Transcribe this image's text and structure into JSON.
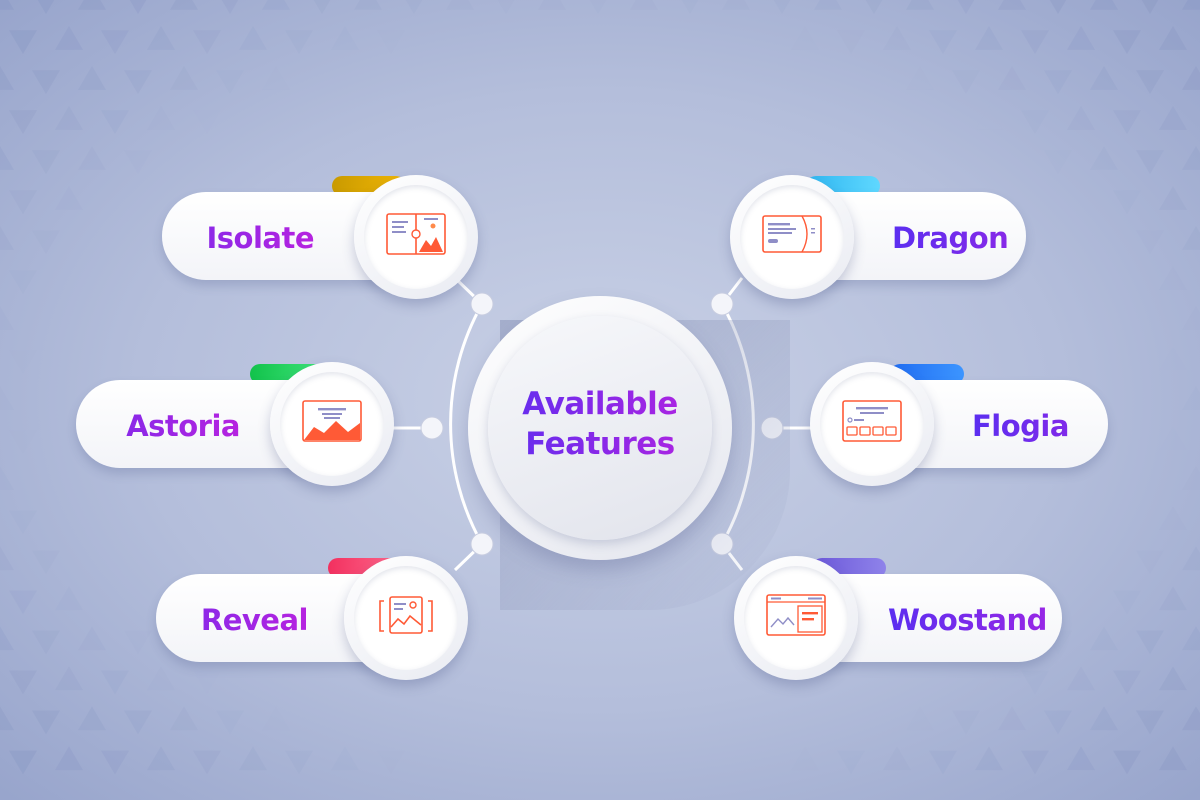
{
  "center": {
    "line1": "Available",
    "line2": "Features"
  },
  "features": [
    {
      "name": "Isolate",
      "icon": "split-image-layout-icon",
      "tab_color": [
        "#c99a00",
        "#f2b705"
      ]
    },
    {
      "name": "Astoria",
      "icon": "hero-banner-layout-icon",
      "tab_color": [
        "#12c24b",
        "#3fe57a"
      ]
    },
    {
      "name": "Reveal",
      "icon": "reveal-image-icon",
      "tab_color": [
        "#f2305f",
        "#ff6b8e"
      ]
    },
    {
      "name": "Dragon",
      "icon": "card-layout-icon",
      "tab_color": [
        "#2fb6f0",
        "#5fd8ff"
      ]
    },
    {
      "name": "Flogia",
      "icon": "grid-layout-icon",
      "tab_color": [
        "#1f6cf2",
        "#3c95ff"
      ]
    },
    {
      "name": "Woostand",
      "icon": "chart-panel-layout-icon",
      "tab_color": [
        "#6b57d9",
        "#8f83ea"
      ]
    }
  ],
  "colors": {
    "background": "#aab4d2",
    "accent_text": "#7a1fe6",
    "connector": "#ffffff",
    "icon_stroke": "#ff5a36"
  }
}
